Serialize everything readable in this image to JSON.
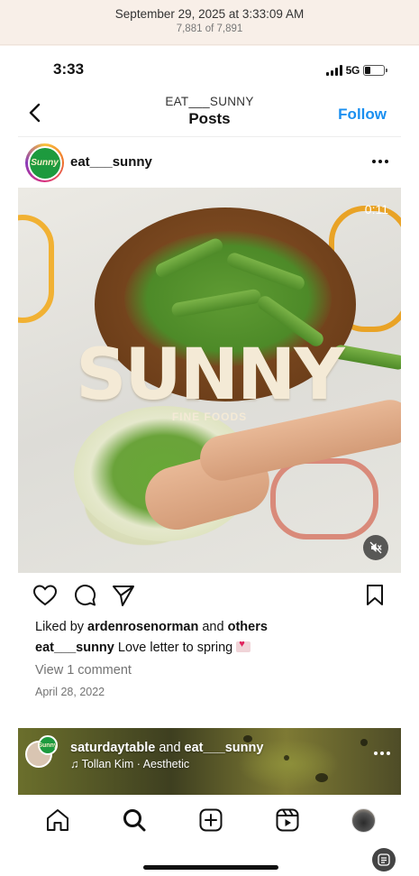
{
  "viewer": {
    "timestamp": "September 29, 2025 at 3:33:09 AM",
    "counter": "7,881 of 7,891"
  },
  "status_bar": {
    "time": "3:33",
    "network": "5G",
    "battery_level_percent": 28
  },
  "nav": {
    "account": "EAT___SUNNY",
    "title": "Posts",
    "follow_label": "Follow"
  },
  "post": {
    "username": "eat___sunny",
    "avatar_text": "Sunny",
    "video_timer": "0:11",
    "media_brand": "SUNNY",
    "media_subtitle": "FINE FOODS",
    "likes": {
      "prefix": "Liked by ",
      "user": "ardenrosenorman",
      "middle": " and ",
      "others": "others"
    },
    "caption": {
      "username": "eat___sunny",
      "text": " Love letter to spring"
    },
    "view_comments": "View 1 comment",
    "date": "April 28, 2022"
  },
  "next_post": {
    "user1": "saturdaytable",
    "and": " and ",
    "user2": "eat___sunny",
    "music": "Tollan Kim · Aesthetic"
  },
  "tabs": [
    "home",
    "search",
    "create",
    "reels",
    "profile"
  ],
  "colors": {
    "follow_blue": "#1a8ff0",
    "sunny_green": "#1d9a3e"
  }
}
